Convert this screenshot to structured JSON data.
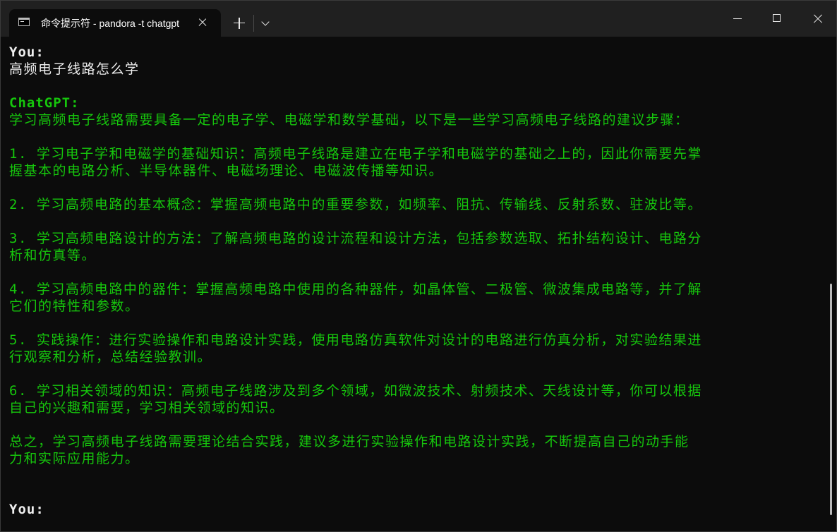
{
  "window": {
    "tab_title": "命令提示符 - pandora  -t chatgpt"
  },
  "conversation": {
    "user_label_1": "You:",
    "user_message": "高频电子线路怎么学",
    "assistant_label": "ChatGPT:",
    "response_lines": [
      "学习高频电子线路需要具备一定的电子学、电磁学和数学基础，以下是一些学习高频电子线路的建议步骤：",
      "",
      "1. 学习电子学和电磁学的基础知识：高频电子线路是建立在电子学和电磁学的基础之上的，因此你需要先掌",
      "握基本的电路分析、半导体器件、电磁场理论、电磁波传播等知识。",
      "",
      "2. 学习高频电路的基本概念：掌握高频电路中的重要参数，如频率、阻抗、传输线、反射系数、驻波比等。",
      "",
      "3. 学习高频电路设计的方法：了解高频电路的设计流程和设计方法，包括参数选取、拓扑结构设计、电路分",
      "析和仿真等。",
      "",
      "4. 学习高频电路中的器件：掌握高频电路中使用的各种器件，如晶体管、二极管、微波集成电路等，并了解",
      "它们的特性和参数。",
      "",
      "5. 实践操作：进行实验操作和电路设计实践，使用电路仿真软件对设计的电路进行仿真分析，对实验结果进",
      "行观察和分析，总结经验教训。",
      "",
      "6. 学习相关领域的知识：高频电子线路涉及到多个领域，如微波技术、射频技术、天线设计等，你可以根据",
      "自己的兴趣和需要，学习相关领域的知识。",
      "",
      "总之，学习高频电子线路需要理论结合实践，建议多进行实验操作和电路设计实践，不断提高自己的动手能",
      "力和实际应用能力。"
    ],
    "user_label_2": "You:"
  },
  "colors": {
    "background": "#0c0c0c",
    "titlebar": "#202020",
    "user_text": "#f0f0f0",
    "assistant_text": "#16c60c"
  }
}
